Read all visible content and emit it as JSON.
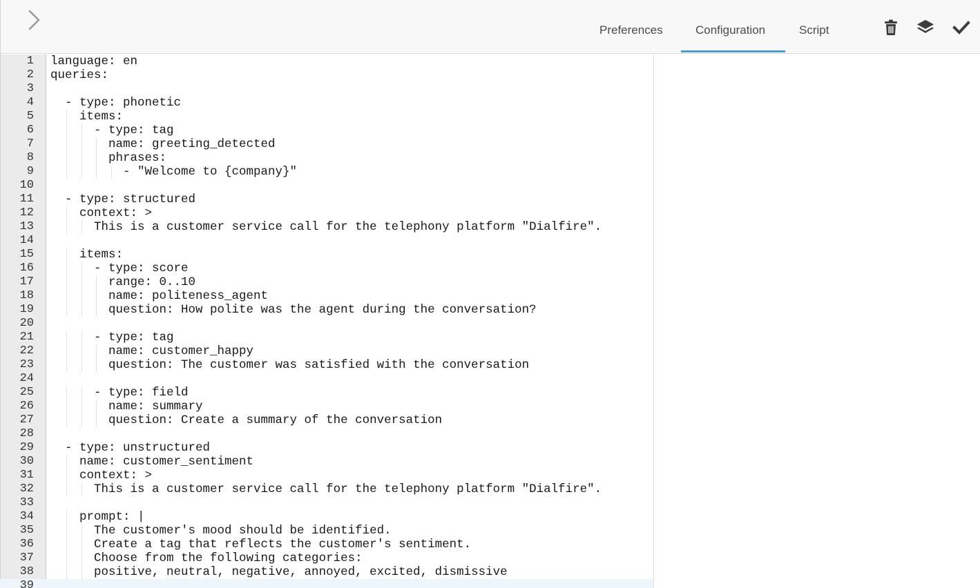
{
  "header": {
    "tabs": [
      {
        "label": "Preferences",
        "active": false
      },
      {
        "label": "Configuration",
        "active": true
      },
      {
        "label": "Script",
        "active": false
      }
    ],
    "icons": [
      "chevron-right-icon",
      "trash-icon",
      "layers-icon",
      "checkmark-icon"
    ],
    "accent_color": "#4a9fd0"
  },
  "editor": {
    "current_line": 39,
    "lines": [
      {
        "n": "1",
        "text": "language: en"
      },
      {
        "n": "2",
        "text": "queries:"
      },
      {
        "n": "3",
        "text": ""
      },
      {
        "n": "4",
        "text": "  - type: phonetic"
      },
      {
        "n": "5",
        "text": "    items:"
      },
      {
        "n": "6",
        "text": "      - type: tag"
      },
      {
        "n": "7",
        "text": "        name: greeting_detected"
      },
      {
        "n": "8",
        "text": "        phrases:"
      },
      {
        "n": "9",
        "text": "          - \"Welcome to {company}\""
      },
      {
        "n": "10",
        "text": ""
      },
      {
        "n": "11",
        "text": "  - type: structured"
      },
      {
        "n": "12",
        "text": "    context: >"
      },
      {
        "n": "13",
        "text": "      This is a customer service call for the telephony platform \"Dialfire\"."
      },
      {
        "n": "14",
        "text": ""
      },
      {
        "n": "15",
        "text": "    items:"
      },
      {
        "n": "16",
        "text": "      - type: score"
      },
      {
        "n": "17",
        "text": "        range: 0..10"
      },
      {
        "n": "18",
        "text": "        name: politeness_agent"
      },
      {
        "n": "19",
        "text": "        question: How polite was the agent during the conversation?"
      },
      {
        "n": "20",
        "text": ""
      },
      {
        "n": "21",
        "text": "      - type: tag"
      },
      {
        "n": "22",
        "text": "        name: customer_happy"
      },
      {
        "n": "23",
        "text": "        question: The customer was satisfied with the conversation"
      },
      {
        "n": "24",
        "text": ""
      },
      {
        "n": "25",
        "text": "      - type: field"
      },
      {
        "n": "26",
        "text": "        name: summary"
      },
      {
        "n": "27",
        "text": "        question: Create a summary of the conversation"
      },
      {
        "n": "28",
        "text": ""
      },
      {
        "n": "29",
        "text": "  - type: unstructured"
      },
      {
        "n": "30",
        "text": "    name: customer_sentiment"
      },
      {
        "n": "31",
        "text": "    context: >"
      },
      {
        "n": "32",
        "text": "      This is a customer service call for the telephony platform \"Dialfire\"."
      },
      {
        "n": "33",
        "text": ""
      },
      {
        "n": "34",
        "text": "    prompt: |"
      },
      {
        "n": "35",
        "text": "      The customer's mood should be identified."
      },
      {
        "n": "36",
        "text": "      Create a tag that reflects the customer's sentiment."
      },
      {
        "n": "37",
        "text": "      Choose from the following categories:"
      },
      {
        "n": "38",
        "text": "      positive, neutral, negative, annoyed, excited, dismissive"
      },
      {
        "n": "39",
        "text": ""
      }
    ]
  }
}
